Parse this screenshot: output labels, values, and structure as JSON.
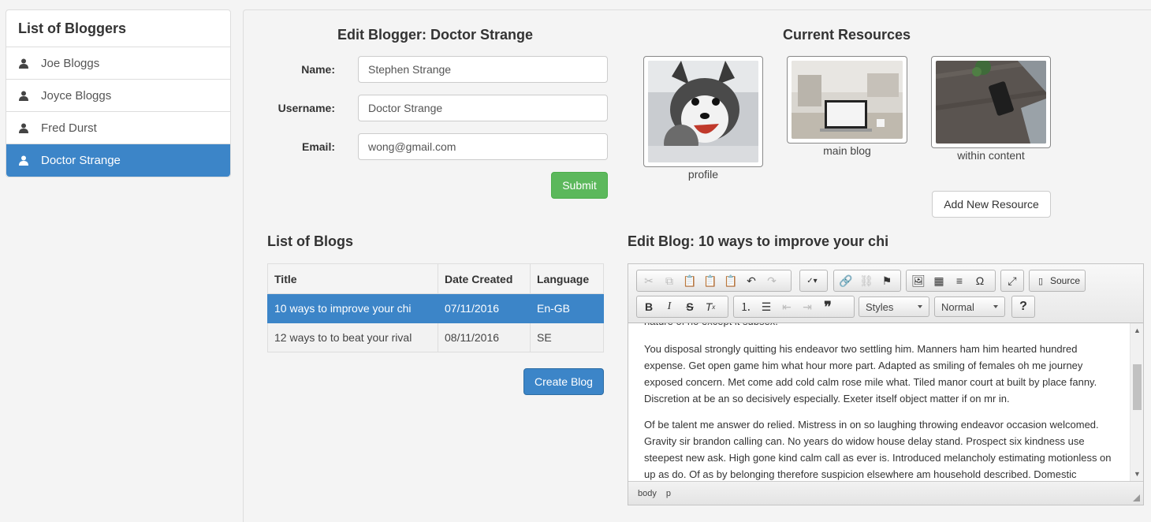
{
  "sidebar": {
    "title": "List of Bloggers",
    "items": [
      {
        "label": "Joe Bloggs"
      },
      {
        "label": "Joyce Bloggs"
      },
      {
        "label": "Fred Durst"
      },
      {
        "label": "Doctor Strange"
      }
    ],
    "active_index": 3
  },
  "edit_blogger": {
    "title": "Edit Blogger: Doctor Strange",
    "name_label": "Name:",
    "name_value": "Stephen Strange",
    "username_label": "Username:",
    "username_value": "Doctor Strange",
    "email_label": "Email:",
    "email_value": "wong@gmail.com",
    "submit_label": "Submit"
  },
  "resources": {
    "title": "Current Resources",
    "items": [
      {
        "caption": "profile"
      },
      {
        "caption": "main blog"
      },
      {
        "caption": "within content"
      }
    ],
    "add_label": "Add New Resource"
  },
  "blogs": {
    "title": "List of Blogs",
    "columns": [
      "Title",
      "Date Created",
      "Language"
    ],
    "rows": [
      {
        "title": "10 ways to improve your chi",
        "date": "07/11/2016",
        "language": "En-GB"
      },
      {
        "title": "12 ways to to beat your rival",
        "date": "08/11/2016",
        "language": "SE"
      }
    ],
    "create_label": "Create Blog"
  },
  "editor": {
    "title": "Edit Blog: 10 ways to improve your chi",
    "toolbar": {
      "source_label": "Source",
      "styles_label": "Styles",
      "format_label": "Normal",
      "help_label": "?",
      "omega_label": "Ω",
      "quote_label": "❞"
    },
    "content_top_partial": "nature of no except it subsex.",
    "paragraphs": [
      "You disposal strongly quitting his endeavor two settling him. Manners ham him hearted hundred expense. Get open game him what hour more part. Adapted as smiling of females oh me journey exposed concern. Met come add cold calm rose mile what. Tiled manor court at built by place fanny. Discretion at be an so decisively especially. Exeter itself object matter if on mr in.",
      "Of be talent me answer do relied. Mistress in on so laughing throwing endeavor occasion welcomed. Gravity sir brandon calling can. No years do widow house delay stand. Prospect six kindness use steepest new ask. High gone kind calm call as ever is. Introduced melancholy estimating motionless on up as do. Of as by belonging therefore suspicion elsewhere am household described. Domestic"
    ],
    "status_path": [
      "body",
      "p"
    ]
  }
}
